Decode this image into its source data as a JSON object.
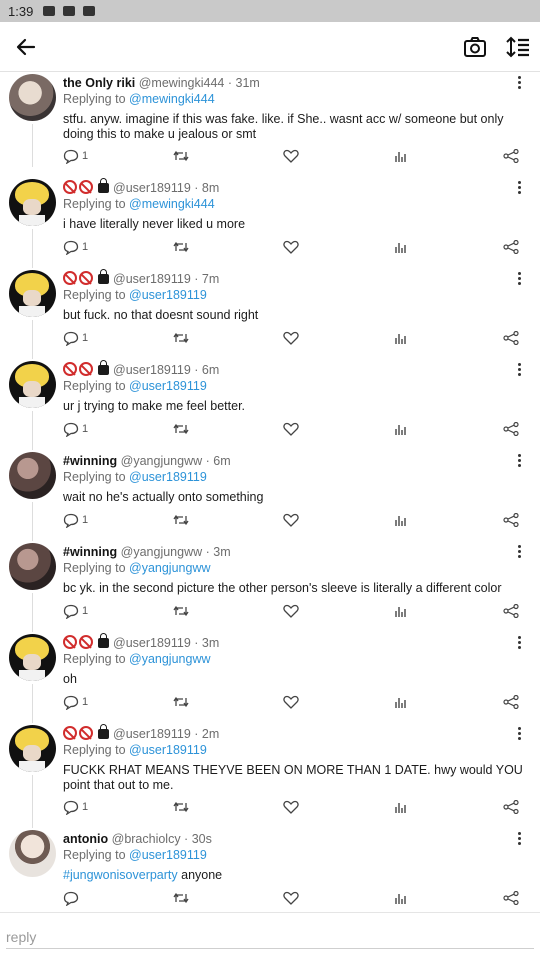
{
  "status": {
    "time": "1:39"
  },
  "topbar": {
    "back_label": "back",
    "camera_label": "camera",
    "sort_label": "sort"
  },
  "posts": [
    {
      "name": "the Only riki",
      "handle": "@mewingki444 · 31m",
      "replying_prefix": "Replying to ",
      "replying_to": "@mewingki444",
      "text": "stfu. anyw. imagine if this was fake. like. if She.. wasnt acc w/ someone but only doing this to make u jealous or smt",
      "reply_count": "1"
    },
    {
      "handle": "@user189119 · 8m",
      "replying_prefix": "Replying to ",
      "replying_to": "@mewingki444",
      "text": "i have literally never liked u more",
      "reply_count": "1"
    },
    {
      "handle": "@user189119 · 7m",
      "replying_prefix": "Replying to ",
      "replying_to": "@user189119",
      "text": "but fuck. no that doesnt sound right",
      "reply_count": "1"
    },
    {
      "handle": "@user189119 · 6m",
      "replying_prefix": "Replying to ",
      "replying_to": "@user189119",
      "text": "ur j trying to make me feel better.",
      "reply_count": "1"
    },
    {
      "name": "#winning",
      "handle": "@yangjungww · 6m",
      "replying_prefix": "Replying to ",
      "replying_to": "@user189119",
      "text": "wait no he's actually onto something",
      "reply_count": "1"
    },
    {
      "name": "#winning",
      "handle": "@yangjungww · 3m",
      "replying_prefix": "Replying to ",
      "replying_to": "@yangjungww",
      "text": "bc yk. in the second picture the other person's sleeve is literally a different color",
      "reply_count": "1"
    },
    {
      "handle": "@user189119 · 3m",
      "replying_prefix": "Replying to ",
      "replying_to": "@yangjungww",
      "text": "oh",
      "reply_count": "1"
    },
    {
      "handle": "@user189119 · 2m",
      "replying_prefix": "Replying to ",
      "replying_to": "@user189119",
      "text": "FUCKK RHAT MEANS THEYVE BEEN ON MORE THAN 1 DATE. hwy would YOU point that out to me.",
      "reply_count": "1"
    },
    {
      "name": "antonio",
      "handle": "@brachiolcy · 30s",
      "replying_prefix": "Replying to ",
      "replying_to": "@user189119",
      "hashtag": "#jungwonisoverparty",
      "text": " anyone",
      "reply_count": ""
    }
  ],
  "reply_bar": {
    "placeholder": "reply"
  }
}
